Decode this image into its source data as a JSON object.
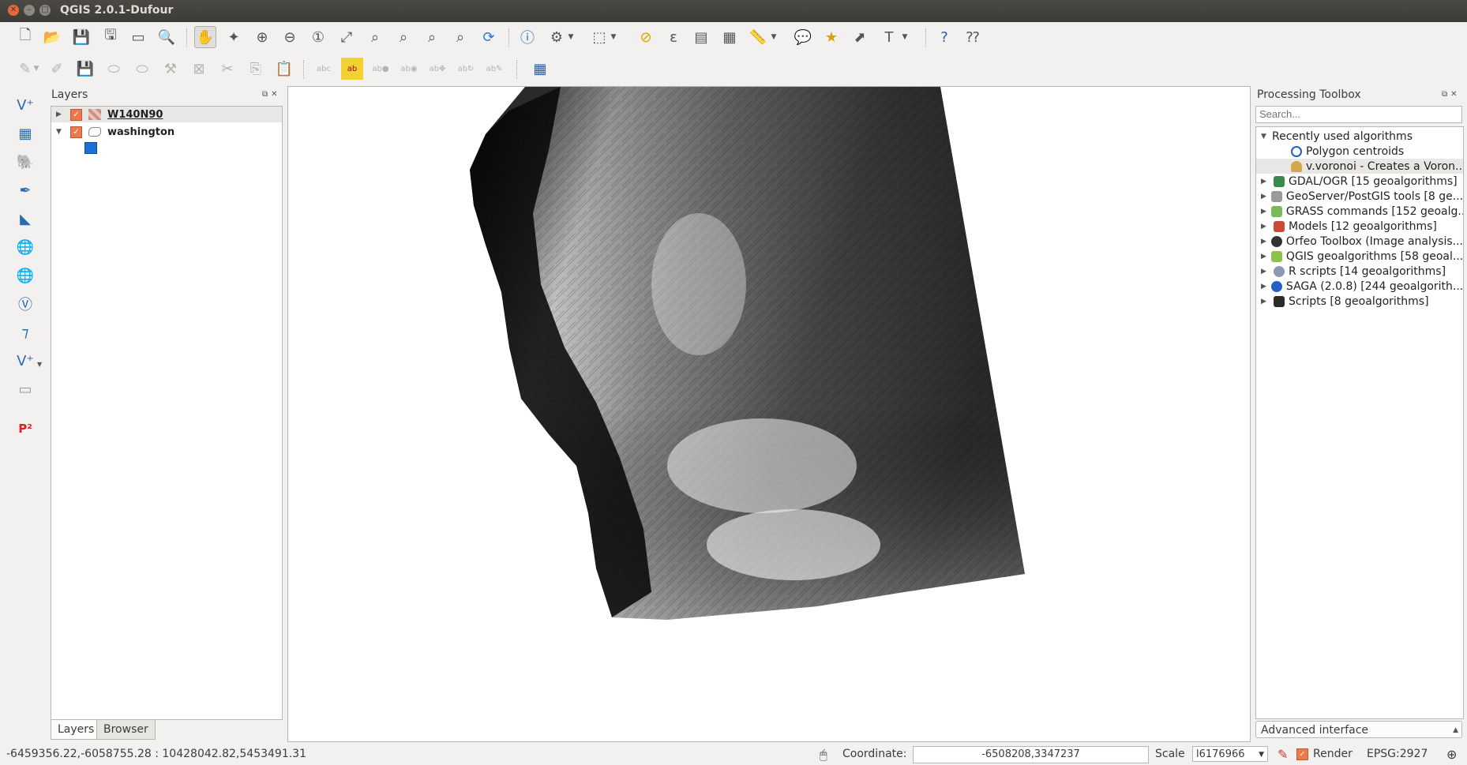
{
  "window": {
    "title": "QGIS 2.0.1-Dufour"
  },
  "layers_panel": {
    "title": "Layers",
    "layers": [
      {
        "name": "W140N90",
        "checked": true,
        "expanded": false,
        "icon": "raster-layer-icon"
      },
      {
        "name": "washington",
        "checked": true,
        "expanded": true,
        "icon": "polygon-layer-icon",
        "symbol_color": "#1a6fd8"
      }
    ],
    "tabs": [
      "Layers",
      "Browser"
    ]
  },
  "processing_panel": {
    "title": "Processing Toolbox",
    "search_placeholder": "Search...",
    "recent": {
      "label": "Recently used algorithms",
      "items": [
        "Polygon centroids",
        "v.voronoi - Creates a Voron..."
      ]
    },
    "groups": [
      "GDAL/OGR [15 geoalgorithms]",
      "GeoServer/PostGIS tools [8 ge...",
      "GRASS commands [152 geoalg...",
      "Models [12 geoalgorithms]",
      "Orfeo Toolbox (Image analysis...",
      "QGIS geoalgorithms [58 geoal...",
      "R scripts [14 geoalgorithms]",
      "SAGA (2.0.8) [244 geoalgorith...",
      "Scripts [8 geoalgorithms]"
    ],
    "interface_mode": "Advanced interface"
  },
  "statusbar": {
    "extents": "-6459356.22,-6058755.28 : 10428042.82,5453491.31",
    "coordinate_label": "Coordinate:",
    "coordinate_value": "-6508208,3347237",
    "scale_label": "Scale",
    "scale_value": "l6176966",
    "render_label": "Render",
    "render_checked": true,
    "crs": "EPSG:2927"
  },
  "left_toolbar": {
    "bottom_label": "P²"
  }
}
